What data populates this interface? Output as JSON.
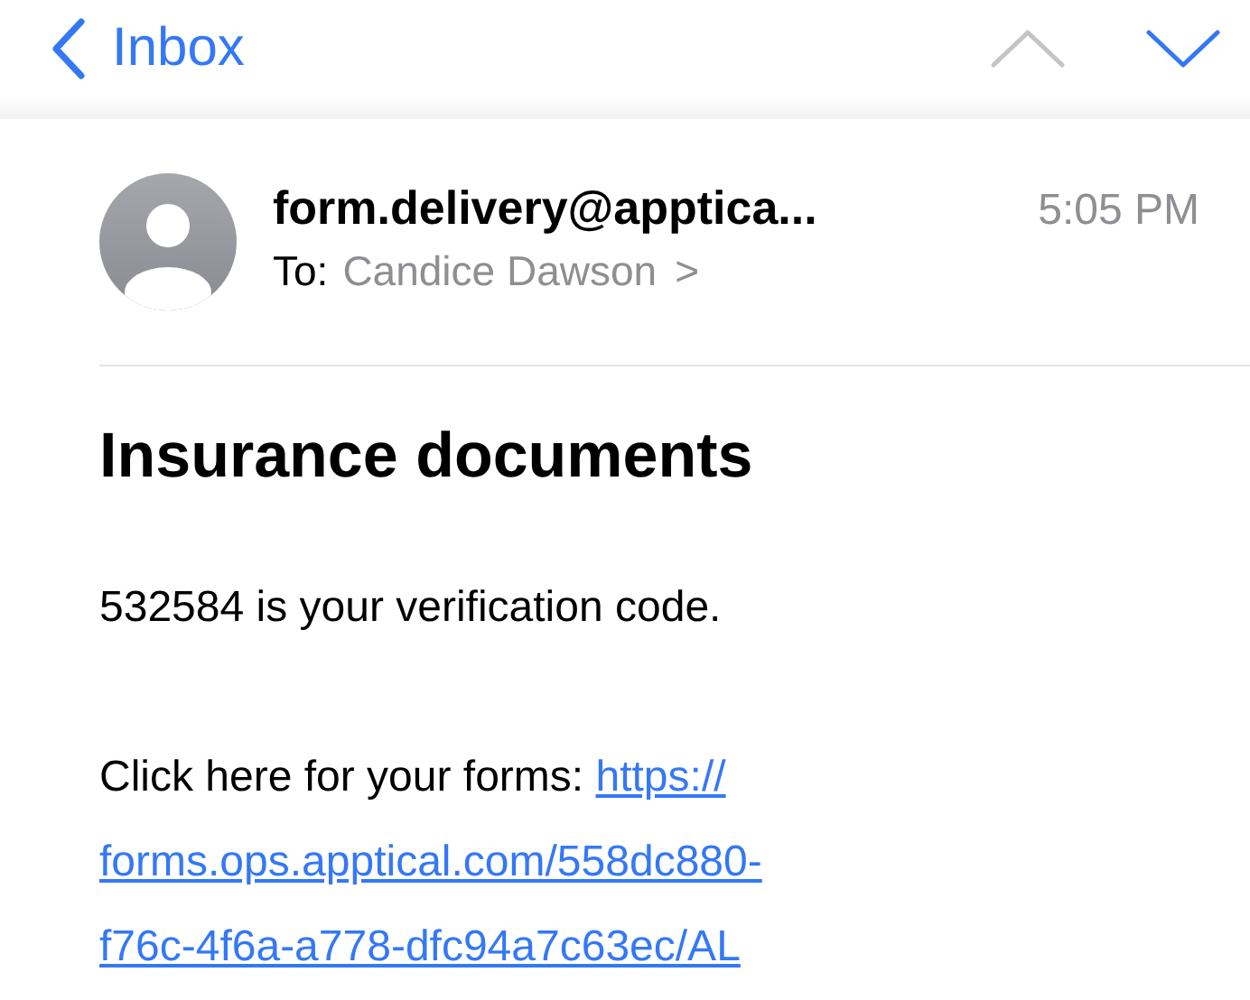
{
  "nav": {
    "back_label": "Inbox",
    "prev_enabled": false,
    "next_enabled": true
  },
  "message": {
    "sender": "form.delivery@apptica...",
    "time": "5:05 PM",
    "to_label": "To:",
    "recipient": "Candice Dawson",
    "recipient_chevron": ">",
    "subject": "Insurance documents",
    "body": "532584 is your verification code.",
    "link_intro": "Click here for your forms:",
    "link_lines": [
      "https://",
      "forms.ops.apptical.com/558dc880-",
      "f76c-4f6a-a778-dfc94a7c63ec/AL"
    ]
  }
}
